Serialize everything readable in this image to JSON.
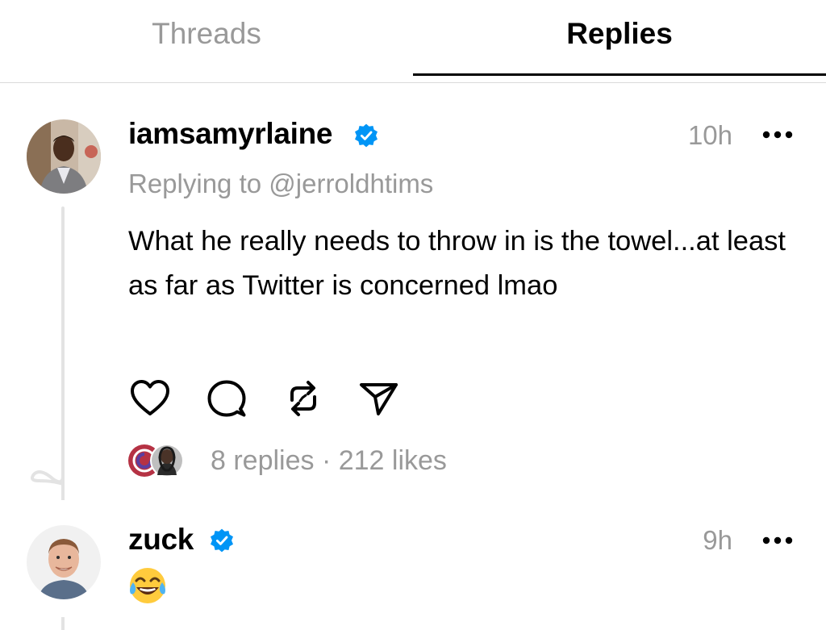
{
  "tabs": {
    "threads_label": "Threads",
    "replies_label": "Replies",
    "active": "Replies"
  },
  "posts": [
    {
      "username": "iamsamyrlaine",
      "verified": true,
      "timestamp": "10h",
      "replying_to": "Replying to @jerroldhtims",
      "text": "What he really needs to throw in is the towel...at least as far as Twitter is concerned lmao",
      "stats": "8 replies · 212 likes"
    },
    {
      "username": "zuck",
      "verified": true,
      "timestamp": "9h",
      "text_emoji": "face-with-tears-of-joy"
    }
  ],
  "colors": {
    "verified_blue": "#0095f6",
    "muted_gray": "#999999",
    "divider": "#dadada",
    "thread_line": "#e3e3e3"
  }
}
